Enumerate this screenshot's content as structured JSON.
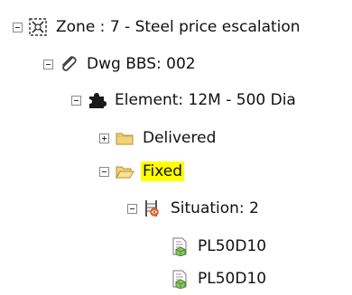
{
  "tree": {
    "zone": {
      "label": "Zone : 7 - Steel price escalation",
      "icon": "zone-icon"
    },
    "drawing": {
      "label": "Dwg BBS: 002",
      "icon": "paperclip-icon"
    },
    "element": {
      "label": "Element: 12M - 500 Dia",
      "icon": "puzzle-icon"
    },
    "delivered": {
      "label": "Delivered",
      "icon": "folder-icon"
    },
    "fixed": {
      "label": "Fixed",
      "icon": "folder-open-icon",
      "highlight_color": "#ffff00"
    },
    "situation": {
      "label": "Situation: 2",
      "icon": "situation-icon"
    },
    "items": [
      {
        "label": "PL50D10",
        "icon": "bar-item-icon"
      },
      {
        "label": "PL50D10",
        "icon": "bar-item-icon"
      }
    ]
  }
}
